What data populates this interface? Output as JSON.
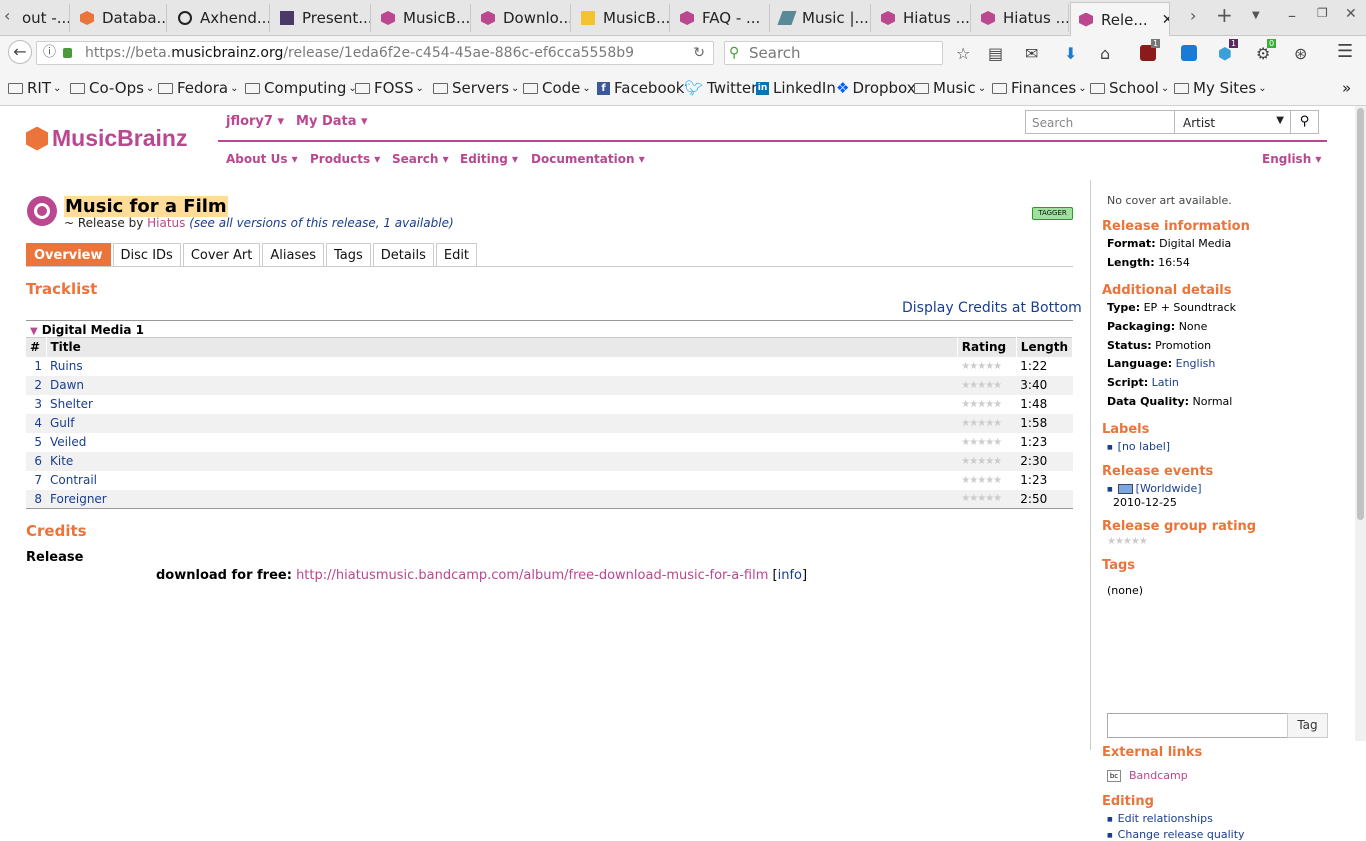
{
  "browser": {
    "tabs": [
      {
        "label": "out -..."
      },
      {
        "label": "Databa..."
      },
      {
        "label": "Axhend..."
      },
      {
        "label": "Present..."
      },
      {
        "label": "MusicB..."
      },
      {
        "label": "Downlo..."
      },
      {
        "label": "MusicB..."
      },
      {
        "label": "FAQ - ..."
      },
      {
        "label": "Music |..."
      },
      {
        "label": "Hiatus ..."
      },
      {
        "label": "Hiatus ..."
      },
      {
        "label": "Rele..."
      }
    ],
    "url_prefix": "https://beta.",
    "url_domain": "musicbrainz.org",
    "url_path": "/release/1eda6f2e-c454-45ae-886c-ef6cca5558b9",
    "search_placeholder": "Search",
    "badges": {
      "ublock": "1",
      "ext1": "1",
      "ext2": "0"
    },
    "bookmarks": [
      {
        "label": "RIT",
        "icon": "folder-icon"
      },
      {
        "label": "Co-Ops",
        "icon": "folder-icon"
      },
      {
        "label": "Fedora",
        "icon": "folder-icon"
      },
      {
        "label": "Computing",
        "icon": "folder-icon"
      },
      {
        "label": "FOSS",
        "icon": "folder-icon"
      },
      {
        "label": "Servers",
        "icon": "folder-icon"
      },
      {
        "label": "Code",
        "icon": "folder-icon"
      },
      {
        "label": "Facebook",
        "icon": "facebook-icon"
      },
      {
        "label": "Twitter",
        "icon": "twitter-icon"
      },
      {
        "label": "LinkedIn",
        "icon": "linkedin-icon"
      },
      {
        "label": "Dropbox",
        "icon": "dropbox-icon"
      },
      {
        "label": "Music",
        "icon": "folder-icon"
      },
      {
        "label": "Finances",
        "icon": "folder-icon"
      },
      {
        "label": "School",
        "icon": "folder-icon"
      },
      {
        "label": "My Sites",
        "icon": "folder-icon"
      }
    ]
  },
  "header": {
    "logo": "MusicBrainz",
    "user_menu": "jflory7 ▾",
    "my_data_menu": "My Data ▾",
    "search_placeholder": "Search",
    "search_type": "Artist",
    "nav": [
      {
        "label": "About Us ▾"
      },
      {
        "label": "Products ▾"
      },
      {
        "label": "Search ▾"
      },
      {
        "label": "Editing ▾"
      },
      {
        "label": "Documentation ▾"
      }
    ],
    "language": "English ▾"
  },
  "release": {
    "title": "Music for a Film",
    "by_prefix": "~ Release by",
    "artist": "Hiatus",
    "versions_link": "(see all versions of this release, 1 available)",
    "tagger": "TAGGER"
  },
  "tabs": [
    {
      "label": "Overview"
    },
    {
      "label": "Disc IDs"
    },
    {
      "label": "Cover Art"
    },
    {
      "label": "Aliases"
    },
    {
      "label": "Tags"
    },
    {
      "label": "Details"
    },
    {
      "label": "Edit"
    }
  ],
  "tracklist": {
    "heading": "Tracklist",
    "display_credits": "Display Credits at Bottom",
    "medium": "Digital Media 1",
    "columns": {
      "num": "#",
      "title": "Title",
      "rating": "Rating",
      "length": "Length"
    },
    "stars": "★★★★★",
    "tracks": [
      {
        "num": "1",
        "title": "Ruins",
        "length": "1:22"
      },
      {
        "num": "2",
        "title": "Dawn",
        "length": "3:40"
      },
      {
        "num": "3",
        "title": "Shelter",
        "length": "1:48"
      },
      {
        "num": "4",
        "title": "Gulf",
        "length": "1:58"
      },
      {
        "num": "5",
        "title": "Veiled",
        "length": "1:23"
      },
      {
        "num": "6",
        "title": "Kite",
        "length": "2:30"
      },
      {
        "num": "7",
        "title": "Contrail",
        "length": "1:23"
      },
      {
        "num": "8",
        "title": "Foreigner",
        "length": "2:50"
      }
    ]
  },
  "credits": {
    "heading": "Credits",
    "release_label": "Release",
    "download_label": "download for free:",
    "download_url": "http://hiatusmusic.bandcamp.com/album/free-download-music-for-a-film",
    "info_open": "[",
    "info": "info",
    "info_close": "]"
  },
  "sidebar": {
    "cover_art": "No cover art available.",
    "release_info_heading": "Release information",
    "format_label": "Format:",
    "format_value": "Digital Media",
    "length_label": "Length:",
    "length_value": "16:54",
    "additional_heading": "Additional details",
    "type_label": "Type:",
    "type_value": "EP + Soundtrack",
    "packaging_label": "Packaging:",
    "packaging_value": "None",
    "status_label": "Status:",
    "status_value": "Promotion",
    "language_label": "Language:",
    "language_value": "English",
    "script_label": "Script:",
    "script_value": "Latin",
    "quality_label": "Data Quality:",
    "quality_value": "Normal",
    "labels_heading": "Labels",
    "label_item": "[no label]",
    "events_heading": "Release events",
    "event_country": "[Worldwide]",
    "event_date": "2010-12-25",
    "rating_heading": "Release group rating",
    "stars": "★★★★★",
    "tags_heading": "Tags",
    "tags_value": "(none)",
    "tag_button": "Tag",
    "external_heading": "External links",
    "bandcamp_icon": "bc",
    "bandcamp": "Bandcamp",
    "editing_heading": "Editing",
    "edit_relationships": "Edit relationships",
    "change_quality": "Change release quality"
  },
  "colors": {
    "brand_purple": "#ba478f",
    "brand_orange": "#eb743b",
    "link_blue": "#1a3e8f"
  }
}
